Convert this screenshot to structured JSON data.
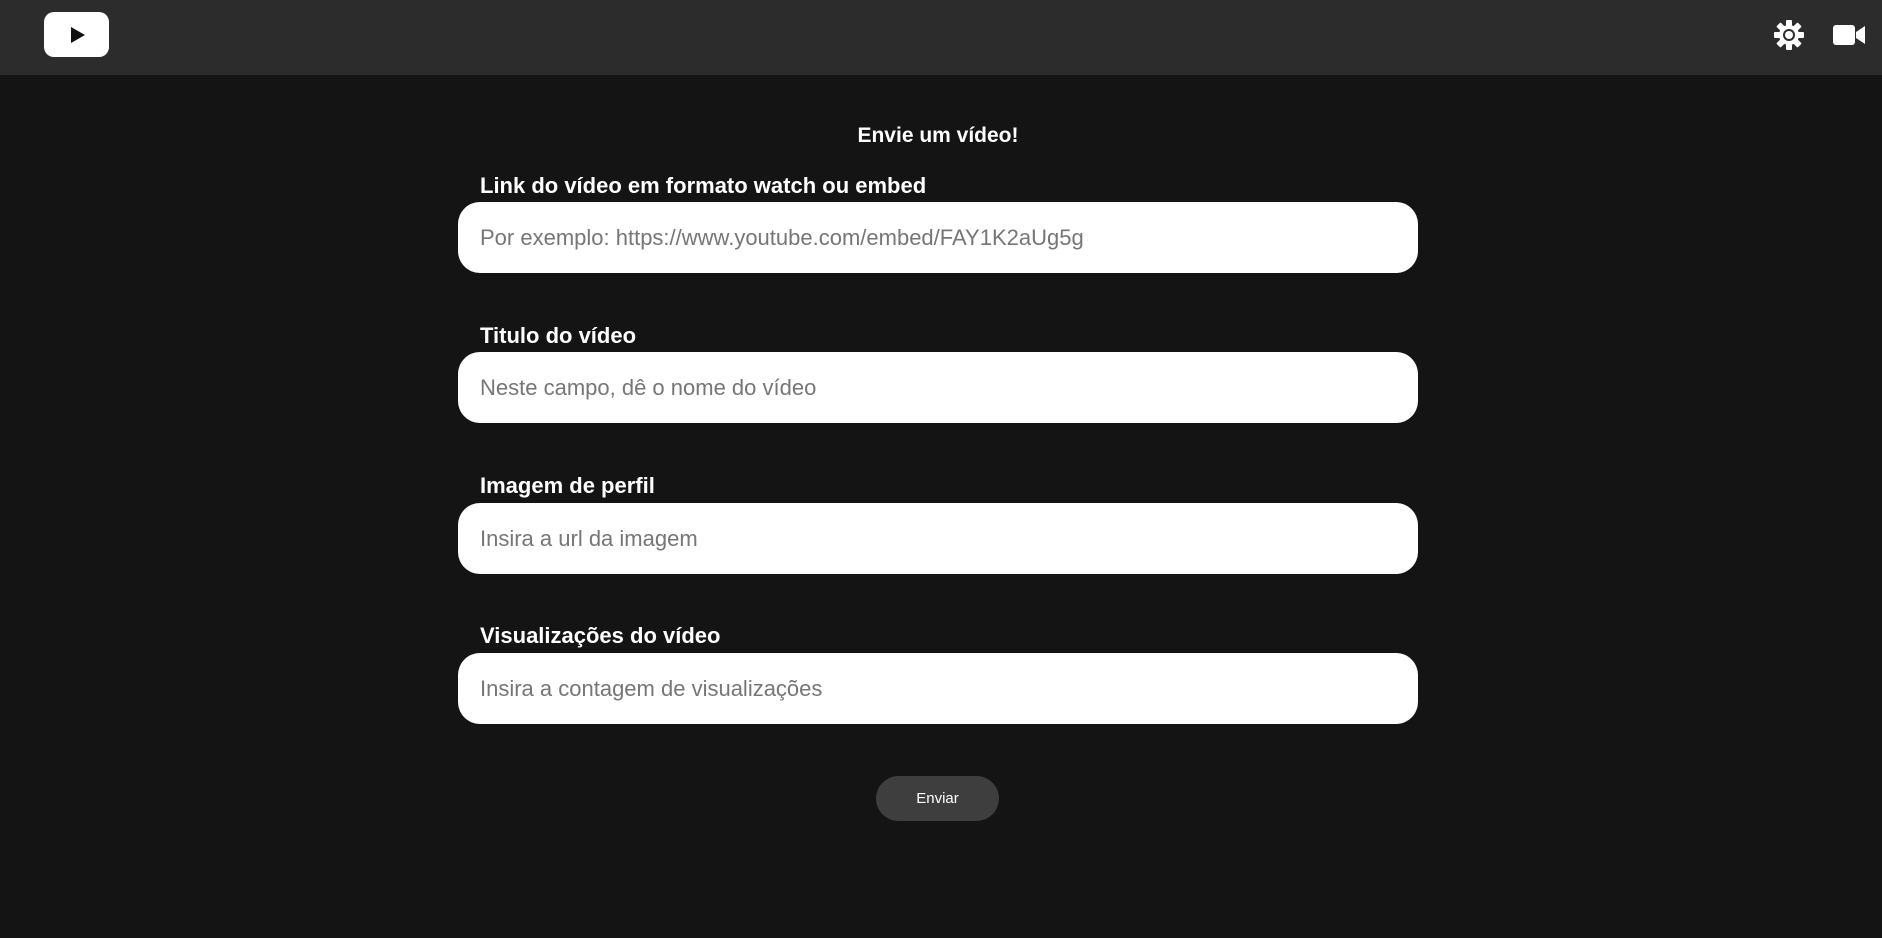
{
  "header": {
    "logo_icon": "play-logo-icon",
    "actions": [
      {
        "icon": "gear-icon"
      },
      {
        "icon": "video-camera-icon"
      }
    ]
  },
  "form": {
    "title": "Envie um vídeo!",
    "fields": [
      {
        "label": "Link do vídeo em formato watch ou embed",
        "value": "",
        "placeholder": "Por exemplo: https://www.youtube.com/embed/FAY1K2aUg5g"
      },
      {
        "label": "Titulo do vídeo",
        "value": "",
        "placeholder": "Neste campo, dê o nome do vídeo"
      },
      {
        "label": "Imagem de perfil",
        "value": "",
        "placeholder": "Insira a url da imagem"
      },
      {
        "label": "Visualizações do vídeo",
        "value": "",
        "placeholder": "Insira a contagem de visualizações"
      }
    ],
    "submit_label": "Enviar"
  },
  "colors": {
    "background": "#141414",
    "header": "#2c2c2c",
    "input_bg": "#ffffff",
    "button_bg": "#3e3e3e",
    "text": "#ffffff"
  }
}
